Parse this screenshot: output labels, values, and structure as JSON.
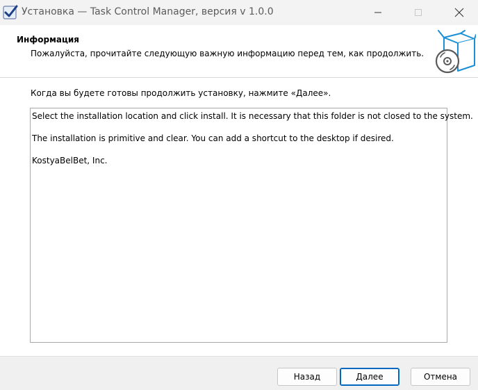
{
  "window": {
    "title": "Установка — Task Control Manager, версия v 1.0.0"
  },
  "header": {
    "title": "Информация",
    "subtitle": "Пожалуйста, прочитайте следующую важную информацию перед тем, как продолжить."
  },
  "body": {
    "prompt": "Когда вы будете готовы продолжить установку, нажмите «Далее».",
    "info_lines": [
      "Select the installation location and click install. It is necessary that this folder is not closed to the system.",
      "The installation is primitive and clear. You can add a shortcut to the desktop if desired.",
      "KostyaBelBet, Inc."
    ]
  },
  "buttons": {
    "back": "Назад",
    "next": "Далее",
    "cancel": "Отмена"
  },
  "icons": {
    "app": "setup-check-icon",
    "header": "box-disc-icon",
    "minimize": "minimize-icon",
    "maximize": "maximize-icon",
    "close": "close-icon"
  },
  "colors": {
    "accent": "#0067c0",
    "header_bg": "#ffffff",
    "window_bg": "#f0f0f0"
  }
}
